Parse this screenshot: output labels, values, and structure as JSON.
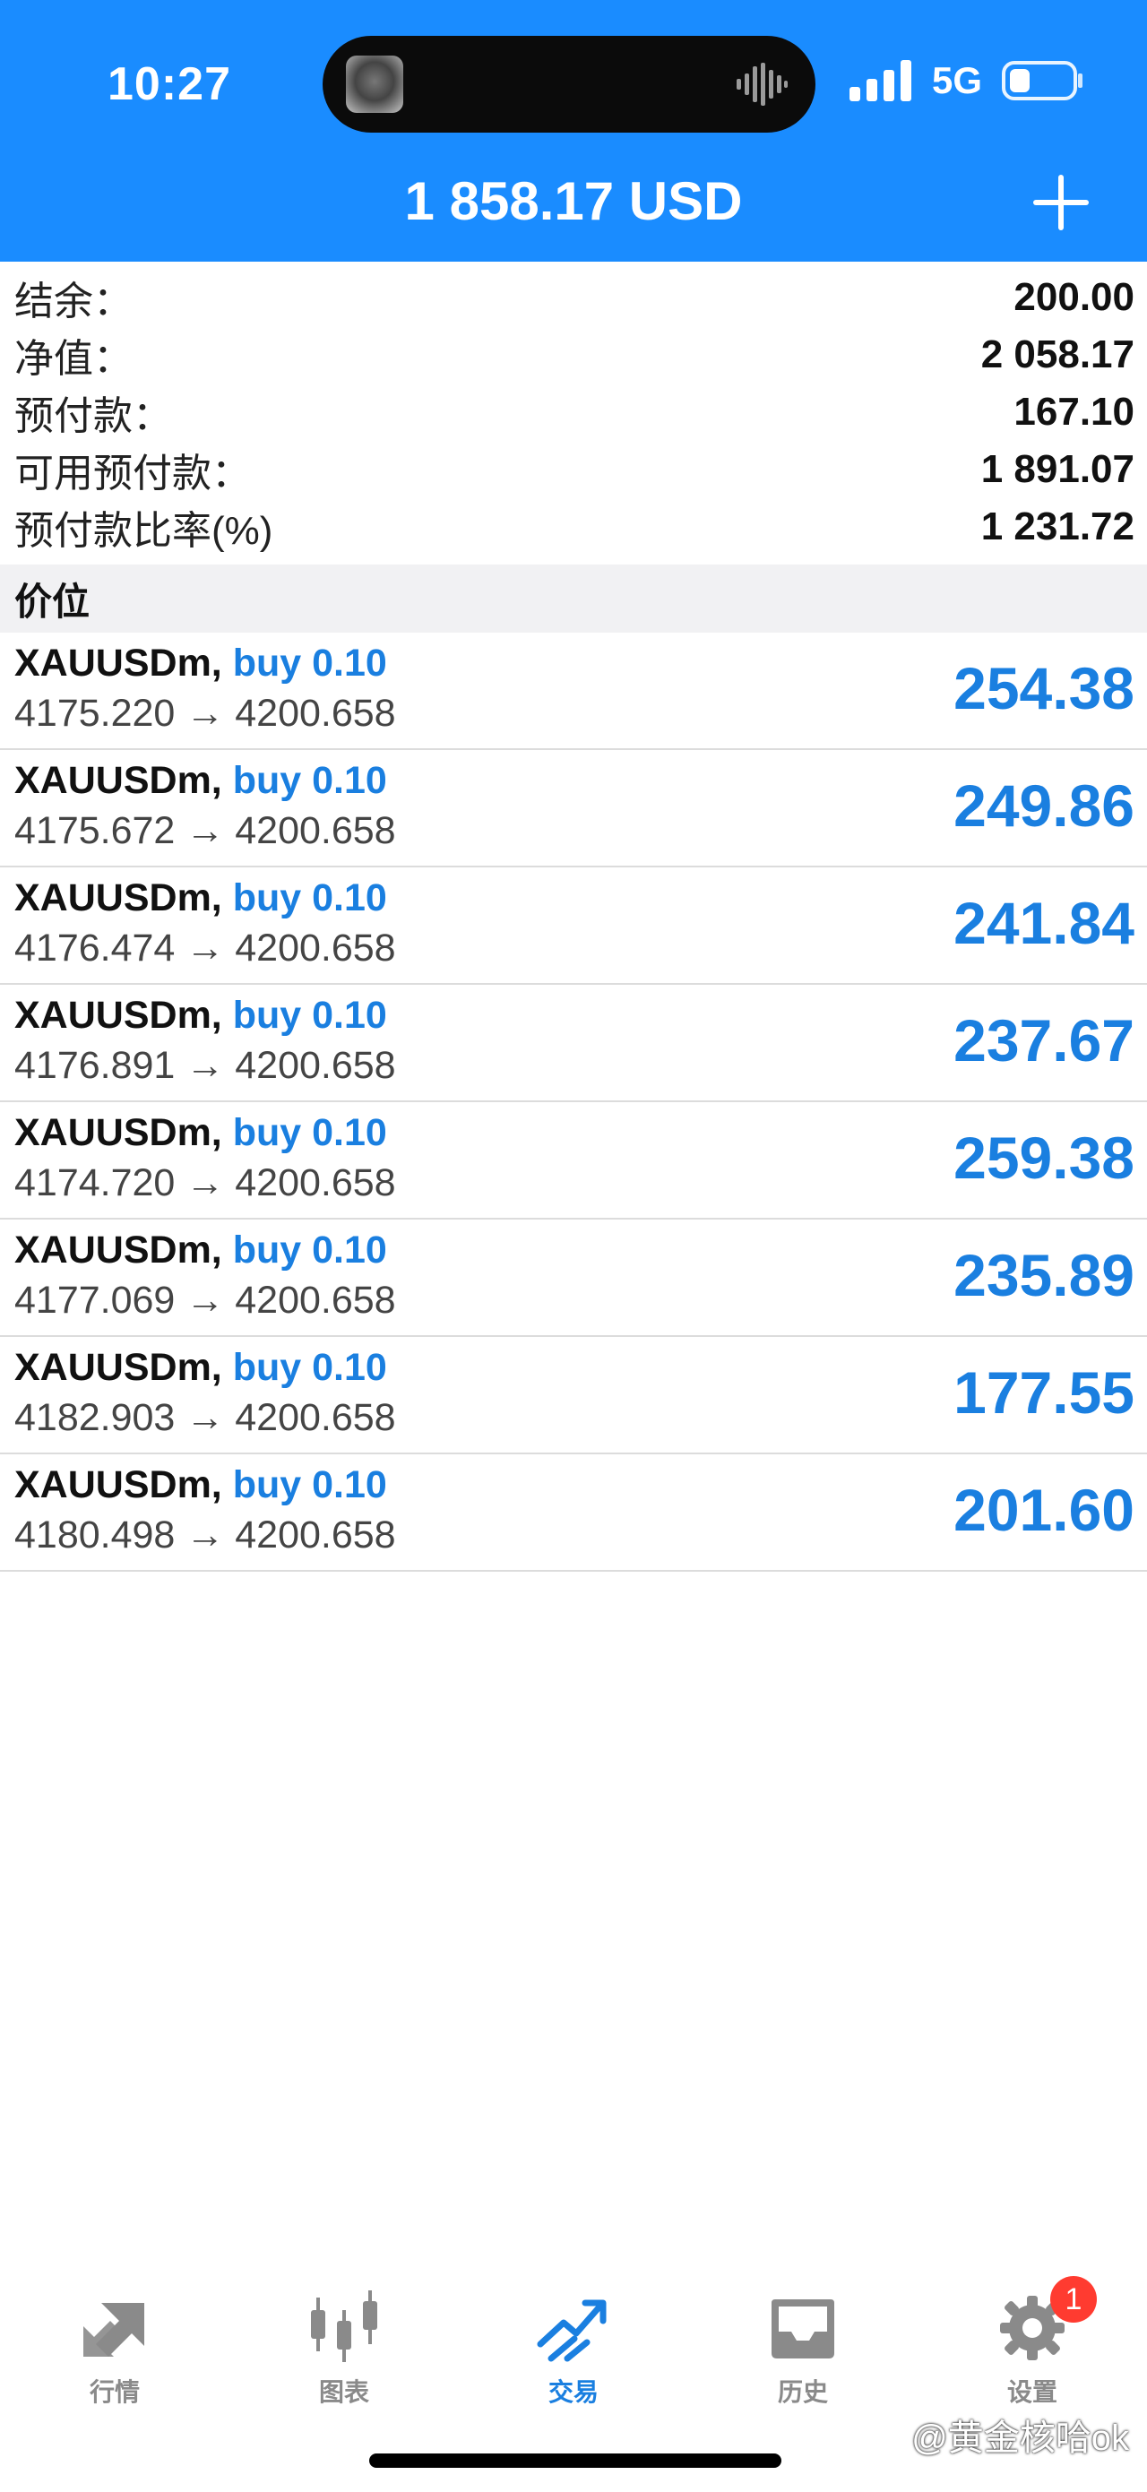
{
  "status_bar": {
    "time": "10:27",
    "network": "5G"
  },
  "header": {
    "balance_title": "1 858.17 USD",
    "add_label": "+"
  },
  "summary": [
    {
      "label": "结余：",
      "value": "200.00"
    },
    {
      "label": "净值：",
      "value": "2 058.17"
    },
    {
      "label": "预付款：",
      "value": "167.10"
    },
    {
      "label": "可用预付款：",
      "value": "1 891.07"
    },
    {
      "label": "预付款比率(%)",
      "value": "1 231.72"
    }
  ],
  "section_title": "价位",
  "positions": [
    {
      "symbol": "XAUUSDm,",
      "side": "buy 0.10",
      "prices": "4175.220 → 4200.658",
      "profit": "254.38"
    },
    {
      "symbol": "XAUUSDm,",
      "side": "buy 0.10",
      "prices": "4175.672 → 4200.658",
      "profit": "249.86"
    },
    {
      "symbol": "XAUUSDm,",
      "side": "buy 0.10",
      "prices": "4176.474 → 4200.658",
      "profit": "241.84"
    },
    {
      "symbol": "XAUUSDm,",
      "side": "buy 0.10",
      "prices": "4176.891 → 4200.658",
      "profit": "237.67"
    },
    {
      "symbol": "XAUUSDm,",
      "side": "buy 0.10",
      "prices": "4174.720 → 4200.658",
      "profit": "259.38"
    },
    {
      "symbol": "XAUUSDm,",
      "side": "buy 0.10",
      "prices": "4177.069 → 4200.658",
      "profit": "235.89"
    },
    {
      "symbol": "XAUUSDm,",
      "side": "buy 0.10",
      "prices": "4182.903 → 4200.658",
      "profit": "177.55"
    },
    {
      "symbol": "XAUUSDm,",
      "side": "buy 0.10",
      "prices": "4180.498 → 4200.658",
      "profit": "201.60"
    }
  ],
  "nav": [
    {
      "label": "行情",
      "icon": "quotes-arrows-icon"
    },
    {
      "label": "图表",
      "icon": "candlestick-chart-icon"
    },
    {
      "label": "交易",
      "icon": "trade-trend-icon",
      "active": true
    },
    {
      "label": "历史",
      "icon": "history-inbox-icon"
    },
    {
      "label": "设置",
      "icon": "settings-gear-icon",
      "badge": "1"
    }
  ],
  "watermark": "@黄金核哈ok",
  "colors": {
    "header_bg": "#1a8cff",
    "profit_blue": "#1a7fe0",
    "badge_red": "#ff3b30",
    "inactive_gray": "#8a8a8a"
  }
}
